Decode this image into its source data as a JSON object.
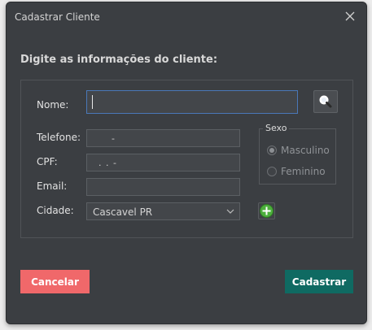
{
  "window": {
    "title": "Cadastrar Cliente"
  },
  "heading": "Digite as informações do cliente:",
  "form": {
    "nome_label": "Nome:",
    "nome_value": "",
    "telefone_label": "Telefone:",
    "telefone_mask": "-",
    "cpf_label": "CPF:",
    "cpf_mask": ". . -",
    "email_label": "Email:",
    "email_value": "",
    "cidade_label": "Cidade:",
    "cidade_selected": "Cascavel PR"
  },
  "sexo": {
    "title": "Sexo",
    "options": [
      {
        "label": "Masculino",
        "checked": true
      },
      {
        "label": "Feminino",
        "checked": false
      }
    ]
  },
  "buttons": {
    "cancel": "Cancelar",
    "submit": "Cadastrar"
  },
  "icons": {
    "close": "close-icon",
    "search": "search-icon",
    "add": "add-city-icon",
    "dropdown": "chevron-down-icon"
  },
  "colors": {
    "cancel": "#f0686a",
    "submit": "#0f6a62",
    "add_icon": "#4caf3c"
  }
}
